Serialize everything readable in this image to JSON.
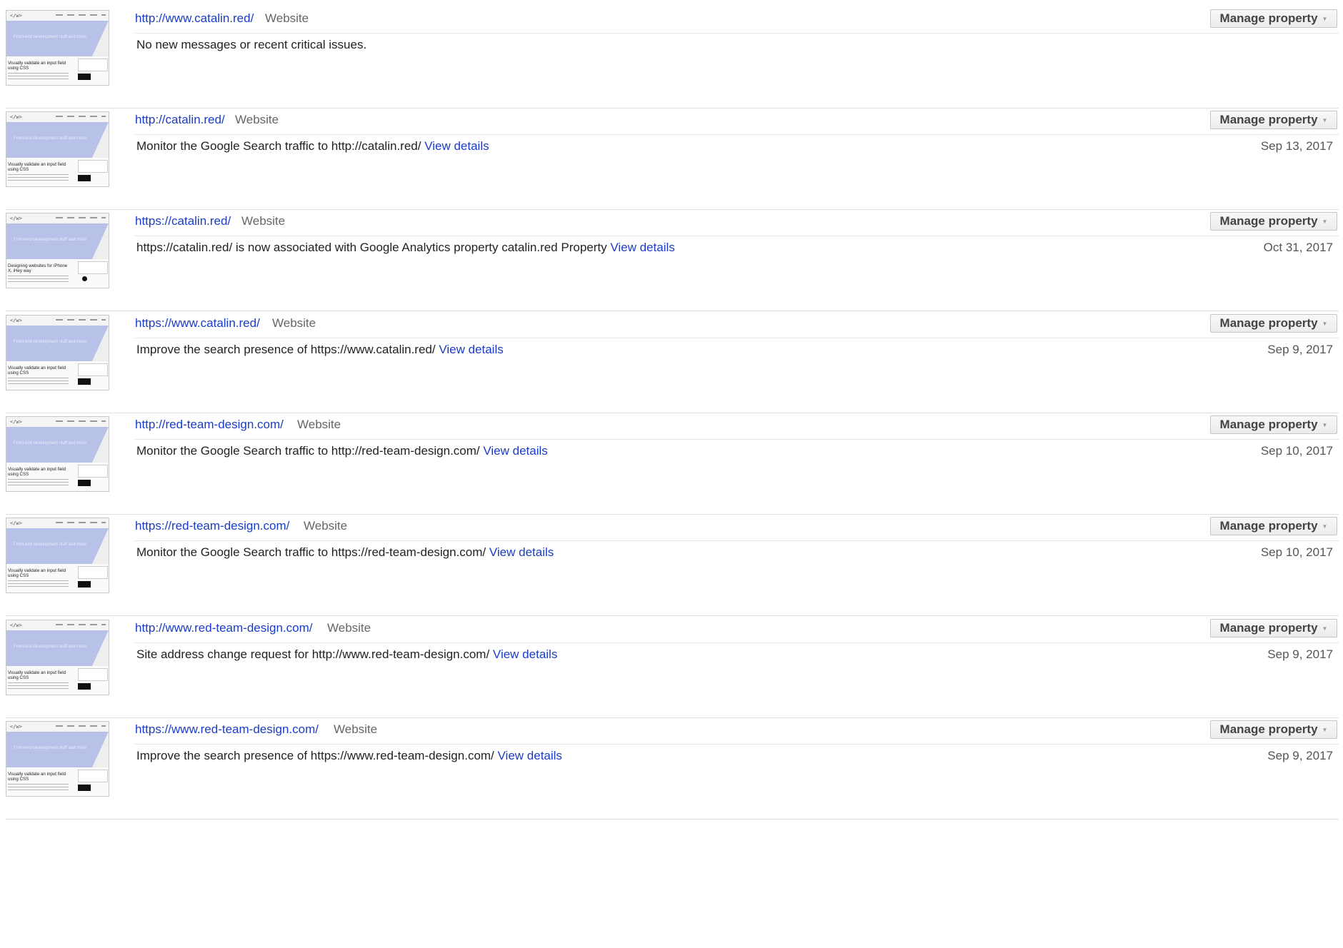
{
  "colors": {
    "link": "#1a3cc8",
    "type_label": "#666666",
    "text": "#222222",
    "thumb_hero": "#b8c1e8"
  },
  "properties": [
    {
      "url": "http://www.catalin.red/",
      "type": "Website",
      "manage_label": "Manage property",
      "message": "No new messages or recent critical issues.",
      "link_label": "",
      "date": "",
      "thumb_title": "Visually validate an input field using CSS",
      "thumb_hero_text": "Front-end development stuff and more",
      "thumb_variant": "dark"
    },
    {
      "url": "http://catalin.red/",
      "type": "Website",
      "manage_label": "Manage property",
      "message": "Monitor the Google Search traffic to http://catalin.red/",
      "link_label": "View details",
      "date": "Sep 13, 2017",
      "thumb_title": "Visually validate an input field using CSS",
      "thumb_hero_text": "Front-end development stuff and more",
      "thumb_variant": "dark"
    },
    {
      "url": "https://catalin.red/",
      "type": "Website",
      "manage_label": "Manage property",
      "message": "https://catalin.red/ is now associated with Google Analytics property catalin.red Property",
      "link_label": "View details",
      "date": "Oct 31, 2017",
      "thumb_title": "Designing websites for iPhone X, iHey way",
      "thumb_hero_text": "Front-end development stuff and more",
      "thumb_variant": "circle"
    },
    {
      "url": "https://www.catalin.red/",
      "type": "Website",
      "manage_label": "Manage property",
      "message": "Improve the search presence of https://www.catalin.red/",
      "link_label": "View details",
      "date": "Sep 9, 2017",
      "thumb_title": "Visually validate an input field using CSS",
      "thumb_hero_text": "Front-end development stuff and more",
      "thumb_variant": "dark"
    },
    {
      "url": "http://red-team-design.com/",
      "type": "Website",
      "manage_label": "Manage property",
      "message": "Monitor the Google Search traffic to http://red-team-design.com/",
      "link_label": "View details",
      "date": "Sep 10, 2017",
      "thumb_title": "Visually validate an input field using CSS",
      "thumb_hero_text": "Front-end development stuff and more",
      "thumb_variant": "dark"
    },
    {
      "url": "https://red-team-design.com/",
      "type": "Website",
      "manage_label": "Manage property",
      "message": "Monitor the Google Search traffic to https://red-team-design.com/",
      "link_label": "View details",
      "date": "Sep 10, 2017",
      "thumb_title": "Visually validate an input field using CSS",
      "thumb_hero_text": "Front-end development stuff and more",
      "thumb_variant": "dark"
    },
    {
      "url": "http://www.red-team-design.com/",
      "type": "Website",
      "manage_label": "Manage property",
      "message": "Site address change request for http://www.red-team-design.com/",
      "link_label": "View details",
      "date": "Sep 9, 2017",
      "thumb_title": "Visually validate an input field using CSS",
      "thumb_hero_text": "Front-end development stuff and more",
      "thumb_variant": "dark"
    },
    {
      "url": "https://www.red-team-design.com/",
      "type": "Website",
      "manage_label": "Manage property",
      "message": "Improve the search presence of https://www.red-team-design.com/",
      "link_label": "View details",
      "date": "Sep 9, 2017",
      "thumb_title": "Visually validate an input field using CSS",
      "thumb_hero_text": "Front-end development stuff and more",
      "thumb_variant": "dark"
    }
  ]
}
